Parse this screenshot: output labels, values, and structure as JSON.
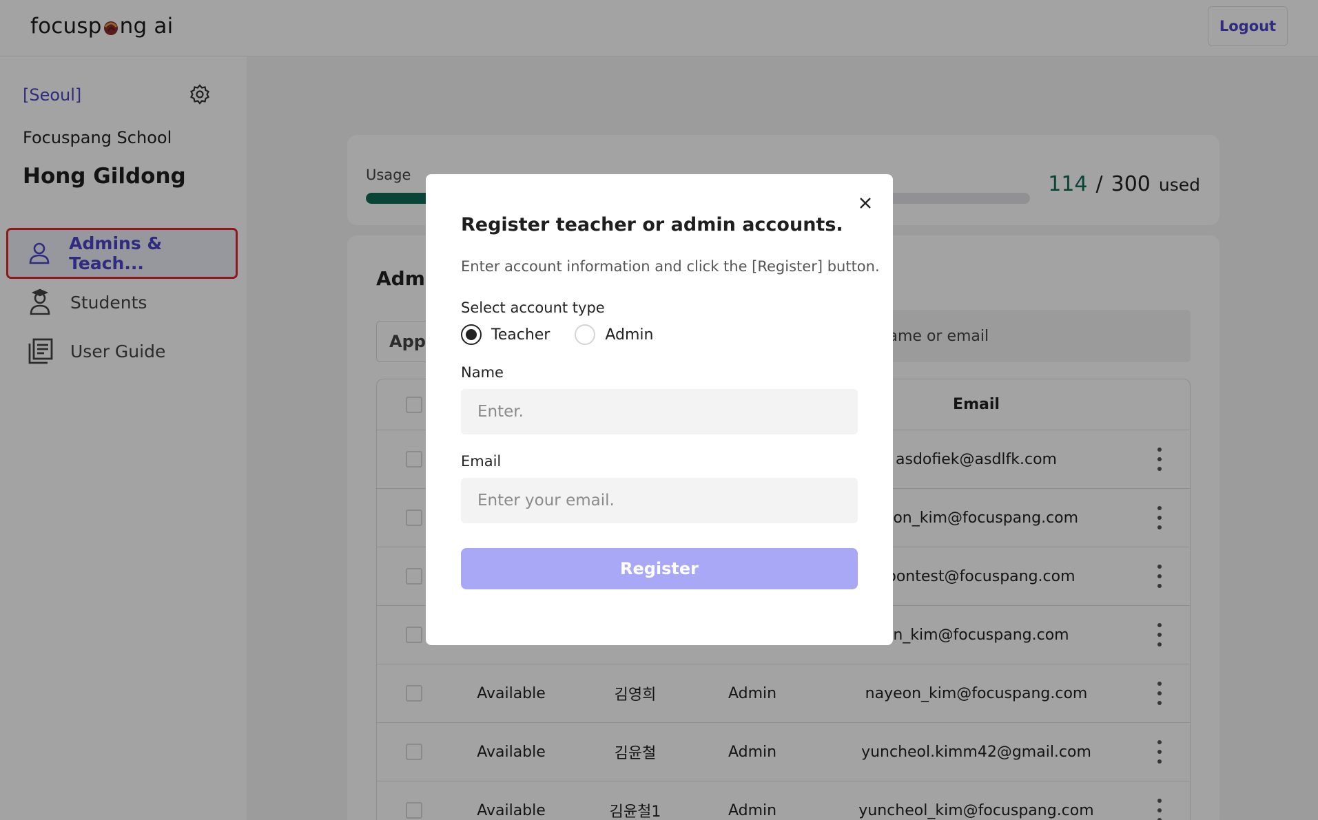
{
  "header": {
    "logo_left": "focusp",
    "logo_right": "ng ai",
    "logout_label": "Logout"
  },
  "sidebar": {
    "region": "[Seoul]",
    "school": "Focuspang School",
    "user_name": "Hong Gildong",
    "items": [
      {
        "label": "Admins & Teach...",
        "icon": "person-icon",
        "active": true
      },
      {
        "label": "Students",
        "icon": "student-icon",
        "active": false
      },
      {
        "label": "User Guide",
        "icon": "book-icon",
        "active": false
      }
    ]
  },
  "usage": {
    "label": "Usage",
    "used": "114",
    "separator": "/",
    "total": "300",
    "suffix": "used",
    "fraction": 0.38,
    "colors": {
      "fill": "#0f6b55",
      "track": "#e3e3e8"
    }
  },
  "list": {
    "title": "Admi",
    "filter_label": "Appr",
    "search_placeholder_visible": "er name or email",
    "header": {
      "email": "Email"
    },
    "rows": [
      {
        "status": "",
        "name": "",
        "role": "",
        "email": "asdofiek@asdlfk.com"
      },
      {
        "status": "",
        "name": "",
        "role": "",
        "email": "hoon_kim@focuspang.com"
      },
      {
        "status": "",
        "name": "",
        "role": "",
        "email": "hoontest@focuspang.com"
      },
      {
        "status": "",
        "name": "",
        "role": "",
        "email": "un_kim@focuspang.com"
      },
      {
        "status": "Available",
        "name": "김영희",
        "role": "Admin",
        "email": "nayeon_kim@focuspang.com"
      },
      {
        "status": "Available",
        "name": "김윤철",
        "role": "Admin",
        "email": "yuncheol.kimm42@gmail.com"
      },
      {
        "status": "Available",
        "name": "김윤철1",
        "role": "Admin",
        "email": "yuncheol_kim@focuspang.com"
      }
    ]
  },
  "modal": {
    "title": "Register teacher or admin accounts.",
    "description": "Enter account information and click the [Register] button.",
    "account_type_label": "Select account type",
    "options": [
      {
        "label": "Teacher",
        "selected": true
      },
      {
        "label": "Admin",
        "selected": false
      }
    ],
    "name_label": "Name",
    "name_placeholder": "Enter.",
    "name_value": "",
    "email_label": "Email",
    "email_placeholder": "Enter your email.",
    "email_value": "",
    "register_label": "Register",
    "register_color": "#a9a8f7"
  },
  "colors": {
    "accent": "#4a45c8",
    "active_outline": "#e0262a"
  }
}
